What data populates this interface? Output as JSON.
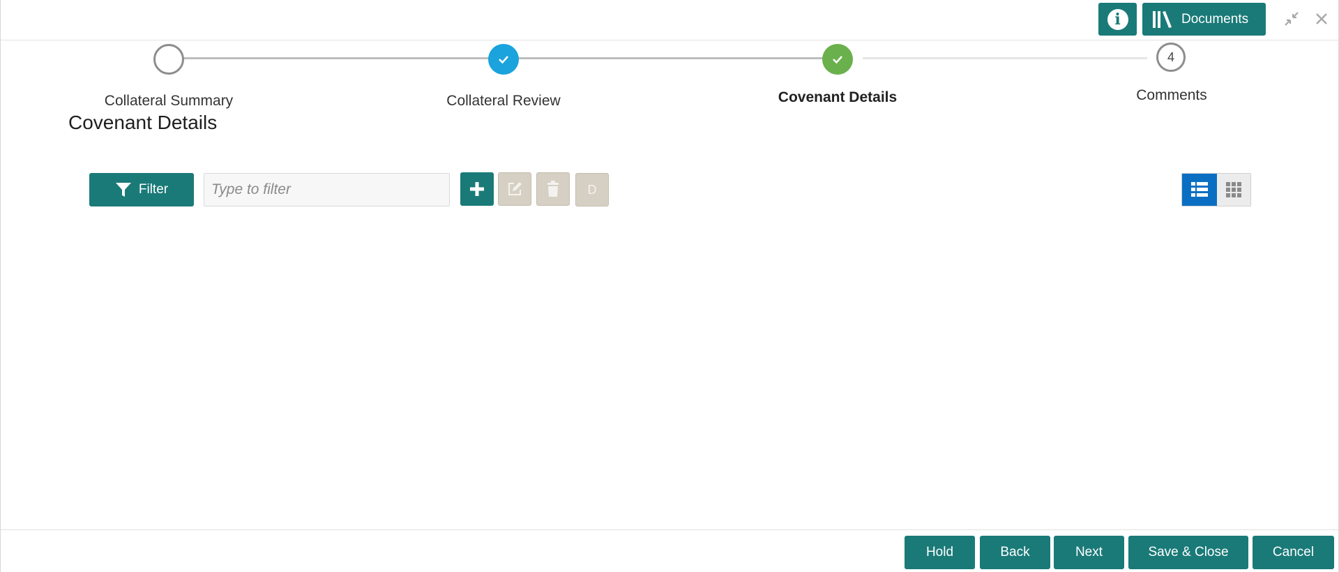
{
  "header": {
    "info_icon": "info-icon",
    "documents_label": "Documents",
    "documents_icon": "library-icon",
    "minimize_icon": "minimize-icon",
    "close_icon": "close-icon"
  },
  "stepper": {
    "steps": [
      {
        "label": "Collateral Summary",
        "state": "pending"
      },
      {
        "label": "Collateral Review",
        "state": "completed"
      },
      {
        "label": "Covenant Details",
        "state": "current"
      },
      {
        "label": "Comments",
        "state": "pending",
        "number": "4"
      }
    ]
  },
  "page": {
    "title": "Covenant Details"
  },
  "toolbar": {
    "filter_label": "Filter",
    "filter_placeholder": "Type to filter",
    "d_label": "D"
  },
  "footer": {
    "hold": "Hold",
    "back": "Back",
    "next": "Next",
    "save_close": "Save & Close",
    "cancel": "Cancel"
  },
  "colors": {
    "teal": "#1a7a78",
    "step_blue": "#1aa3dc",
    "step_green": "#6ab04c",
    "view_blue": "#0a6fc2"
  }
}
